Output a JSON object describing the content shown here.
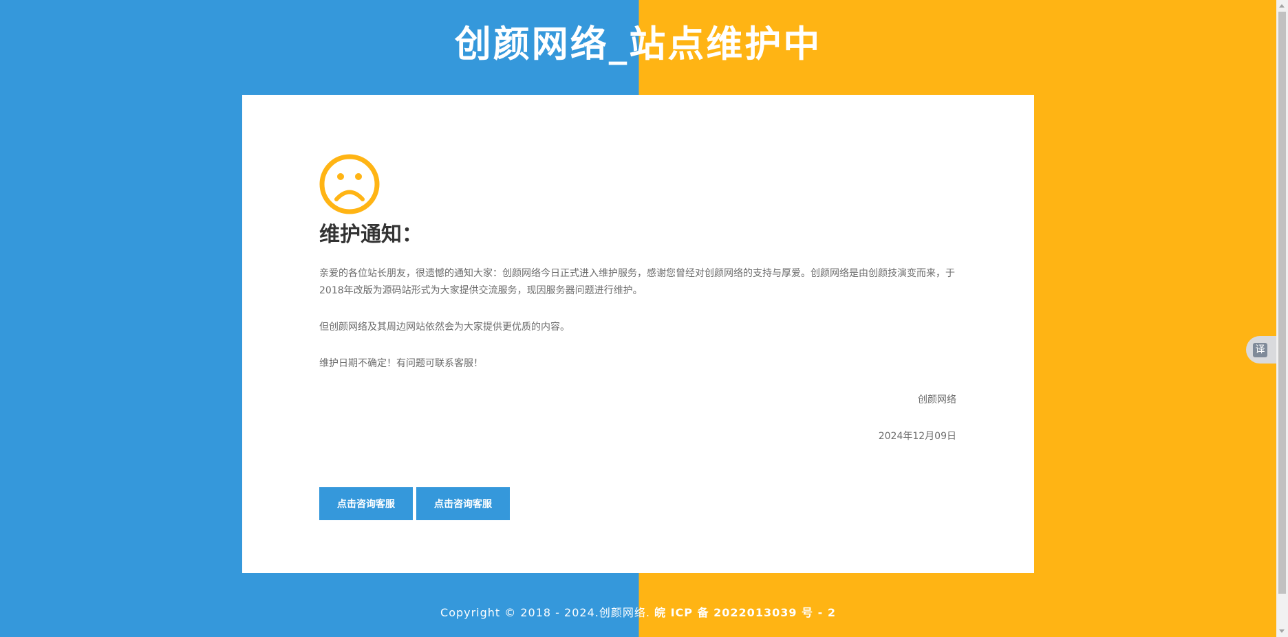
{
  "header": {
    "title": "创颜网络_站点维护中"
  },
  "notice": {
    "icon": "sad-face-icon",
    "icon_color": "#ffb414",
    "heading": "维护通知：",
    "paragraph1": "亲爱的各位站长朋友，很遗憾的通知大家：创颜网络今日正式进入维护服务，感谢您曾经对创颜网络的支持与厚爱。创颜网络是由创颜技演变而来，于2018年改版为源码站形式为大家提供交流服务，现因服务器问题进行维护。",
    "paragraph2": "但创颜网络及其周边网站依然会为大家提供更优质的内容。",
    "paragraph3": "维护日期不确定！有问题可联系客服！",
    "signature": "创颜网络",
    "date": "2024年12月09日"
  },
  "buttons": {
    "contact1_label": "点击咨询客服",
    "contact2_label": "点击咨询客服"
  },
  "footer": {
    "copyright": "Copyright © 2018 - 2024.创颜网络. ",
    "icp": "皖 ICP 备 2022013039 号 - 2"
  },
  "translate": {
    "label": "译",
    "icon": "translate-icon"
  },
  "colors": {
    "blue": "#3598db",
    "orange": "#ffb414",
    "card": "#ffffff"
  }
}
